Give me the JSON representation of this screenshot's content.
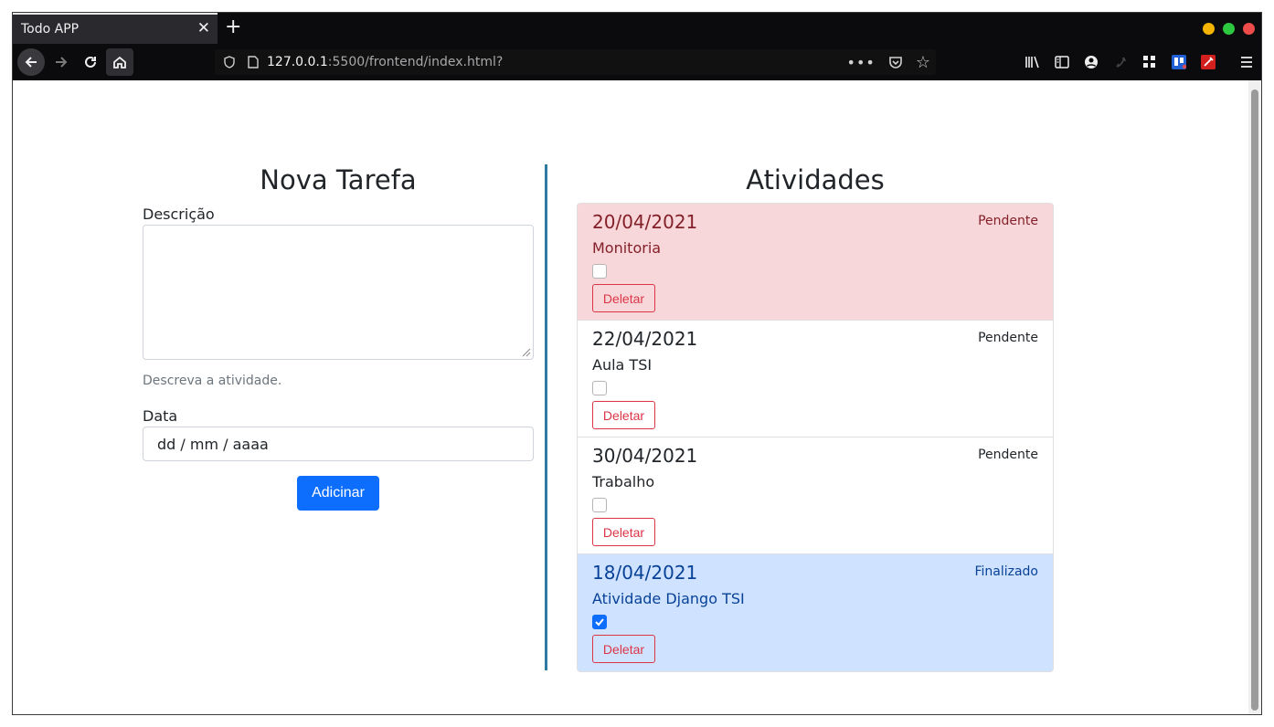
{
  "browser": {
    "tab_title": "Todo APP",
    "url_host": "127.0.0.1",
    "url_path": ":5500/frontend/index.html?"
  },
  "form": {
    "title": "Nova Tarefa",
    "description_label": "Descrição",
    "description_value": "",
    "description_help": "Descreva a atividade.",
    "date_label": "Data",
    "date_placeholder": "dd / mm / aaaa",
    "submit_label": "Adicinar"
  },
  "activities": {
    "title": "Atividades",
    "items": [
      {
        "date": "20/04/2021",
        "status": "Pendente",
        "description": "Monitoria",
        "checked": false,
        "style": "danger",
        "delete_label": "Deletar"
      },
      {
        "date": "22/04/2021",
        "status": "Pendente",
        "description": "Aula TSI",
        "checked": false,
        "style": "plain",
        "delete_label": "Deletar"
      },
      {
        "date": "30/04/2021",
        "status": "Pendente",
        "description": "Trabalho",
        "checked": false,
        "style": "plain",
        "delete_label": "Deletar"
      },
      {
        "date": "18/04/2021",
        "status": "Finalizado",
        "description": "Atividade Django TSI",
        "checked": true,
        "style": "primary",
        "delete_label": "Deletar"
      }
    ]
  },
  "colors": {
    "primary": "#0d6efd",
    "danger": "#dc3545",
    "divider": "#2f7aa4"
  }
}
